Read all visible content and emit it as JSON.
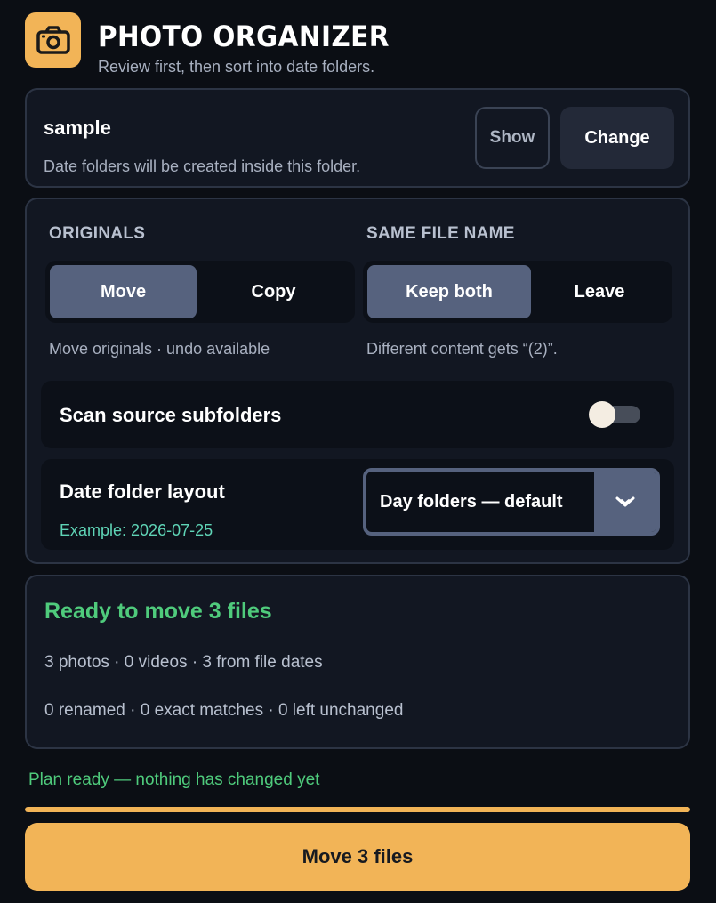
{
  "header": {
    "title": "PHOTO ORGANIZER",
    "subtitle": "Review first, then sort into date folders.",
    "logo_icon": "camera-icon"
  },
  "folder": {
    "name": "sample",
    "note": "Date folders will be created inside this folder.",
    "show_label": "Show",
    "change_label": "Change"
  },
  "originals": {
    "label": "ORIGINALS",
    "options": [
      "Move",
      "Copy"
    ],
    "selected": "Move",
    "hint": "Move originals · undo available"
  },
  "same_name": {
    "label": "SAME FILE NAME",
    "options": [
      "Keep both",
      "Leave"
    ],
    "selected": "Keep both",
    "hint": "Different content gets “(2)”."
  },
  "subfolders": {
    "label": "Scan source subfolders",
    "enabled": false
  },
  "layout": {
    "label": "Date folder layout",
    "example": "Example: 2026-07-25",
    "selected": "Day folders — default",
    "arrow_icon": "chevron-down-icon"
  },
  "summary": {
    "title": "Ready to move 3 files",
    "line1": "3 photos · 0 videos · 3 from file dates",
    "line2": "0 renamed · 0 exact matches · 0 left unchanged"
  },
  "status": {
    "text": "Plan ready — nothing has changed yet",
    "progress": 1.0
  },
  "action": {
    "label": "Move 3 files"
  },
  "colors": {
    "accent": "#f2b457",
    "success": "#4fcb7c",
    "example": "#5fd4b6",
    "segment_active": "#56627e"
  }
}
